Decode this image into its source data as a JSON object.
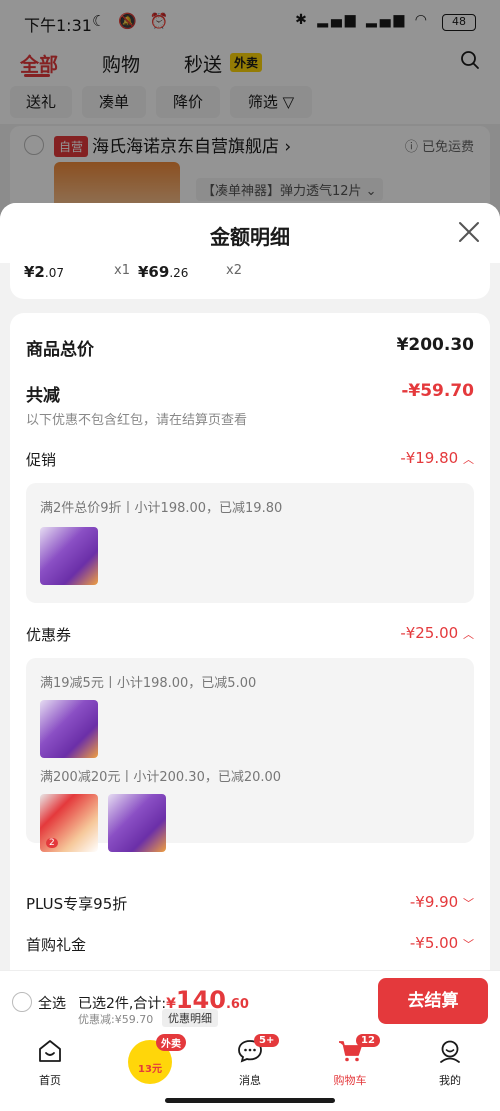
{
  "status_bar": {
    "time": "下午1:31",
    "battery": "48"
  },
  "header": {
    "tabs": [
      {
        "label": "全部"
      },
      {
        "label": "购物"
      },
      {
        "label": "秒送"
      }
    ],
    "waimai_tag": "外卖",
    "chips": [
      "送礼",
      "凑单",
      "降价",
      "筛选"
    ]
  },
  "store": {
    "tag": "自营",
    "name": "海氏海诺京东自营旗舰店",
    "shipping": "已免运费",
    "variant": "【凑单神器】弹力透气12片"
  },
  "sheet": {
    "title": "金额明细",
    "top_items": [
      {
        "price_int": "¥2",
        "price_dec": ".07",
        "qty": "x1"
      },
      {
        "price_int": "¥69",
        "price_dec": ".26",
        "qty": "x2"
      }
    ],
    "total_label": "商品总价",
    "total_value": "¥200.30",
    "reduce_label": "共减",
    "reduce_value": "-¥59.70",
    "reduce_note": "以下优惠不包含红包，请在结算页查看",
    "promo": {
      "label": "促销",
      "value": "-¥19.80",
      "rules": [
        {
          "text": "满2件总价9折丨小计198.00，已减19.80"
        }
      ]
    },
    "coupon": {
      "label": "优惠券",
      "value": "-¥25.00",
      "rules": [
        {
          "text": "满19减5元丨小计198.00，已减5.00"
        },
        {
          "text": "满200减20元丨小计200.30，已减20.00"
        }
      ],
      "qty_badge": "2"
    },
    "plus": {
      "label": "PLUS专享95折",
      "value": "-¥9.90"
    },
    "first": {
      "label": "首购礼金",
      "value": "-¥5.00"
    }
  },
  "bottom_bar": {
    "select_all": "全选",
    "selected": "已选2件,合计:",
    "currency": "¥",
    "total_int": "140",
    "total_dec": ".60",
    "discount": "优惠减:¥59.70",
    "detail_button": "优惠明细",
    "checkout": "去结算"
  },
  "nav": {
    "items": [
      {
        "label": "首页"
      },
      {
        "label": "13元",
        "badge": "外卖"
      },
      {
        "label": "消息",
        "badge": "5+"
      },
      {
        "label": "购物车",
        "badge": "12"
      },
      {
        "label": "我的"
      }
    ]
  },
  "colors": {
    "accent": "#e4393c",
    "waimai": "#ffd60a"
  }
}
